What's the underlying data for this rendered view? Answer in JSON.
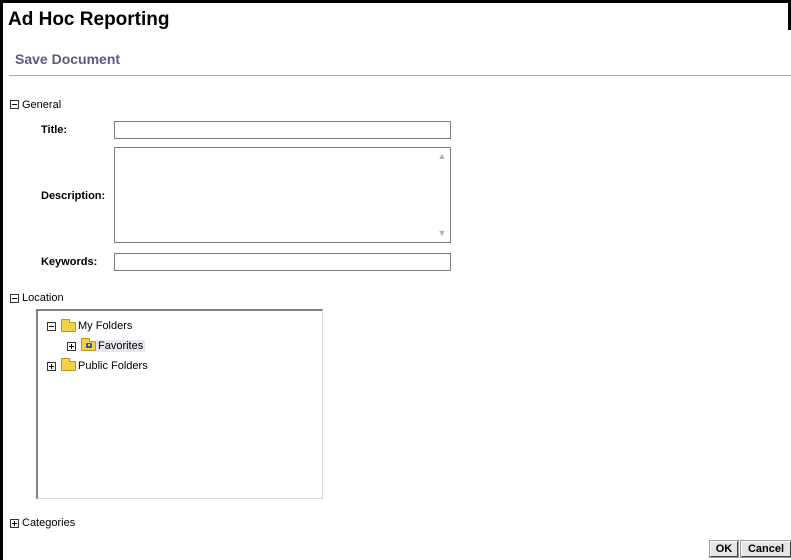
{
  "header": {
    "app_title": "Ad Hoc Reporting",
    "page_title": "Save Document"
  },
  "general": {
    "label": "General",
    "expanded": true,
    "title_label": "Title:",
    "title_value": "",
    "description_label": "Description:",
    "description_value": "",
    "keywords_label": "Keywords:",
    "keywords_value": ""
  },
  "location": {
    "label": "Location",
    "expanded": true,
    "tree": [
      {
        "label": "My Folders",
        "expanded": true,
        "icon": "folder-icon"
      },
      {
        "label": "Favorites",
        "expanded": false,
        "selected": true,
        "icon": "favorites-folder-icon"
      },
      {
        "label": "Public Folders",
        "expanded": false,
        "icon": "folder-icon"
      }
    ]
  },
  "categories": {
    "label": "Categories",
    "expanded": false
  },
  "actions": {
    "ok_label": "OK",
    "cancel_label": "Cancel"
  }
}
